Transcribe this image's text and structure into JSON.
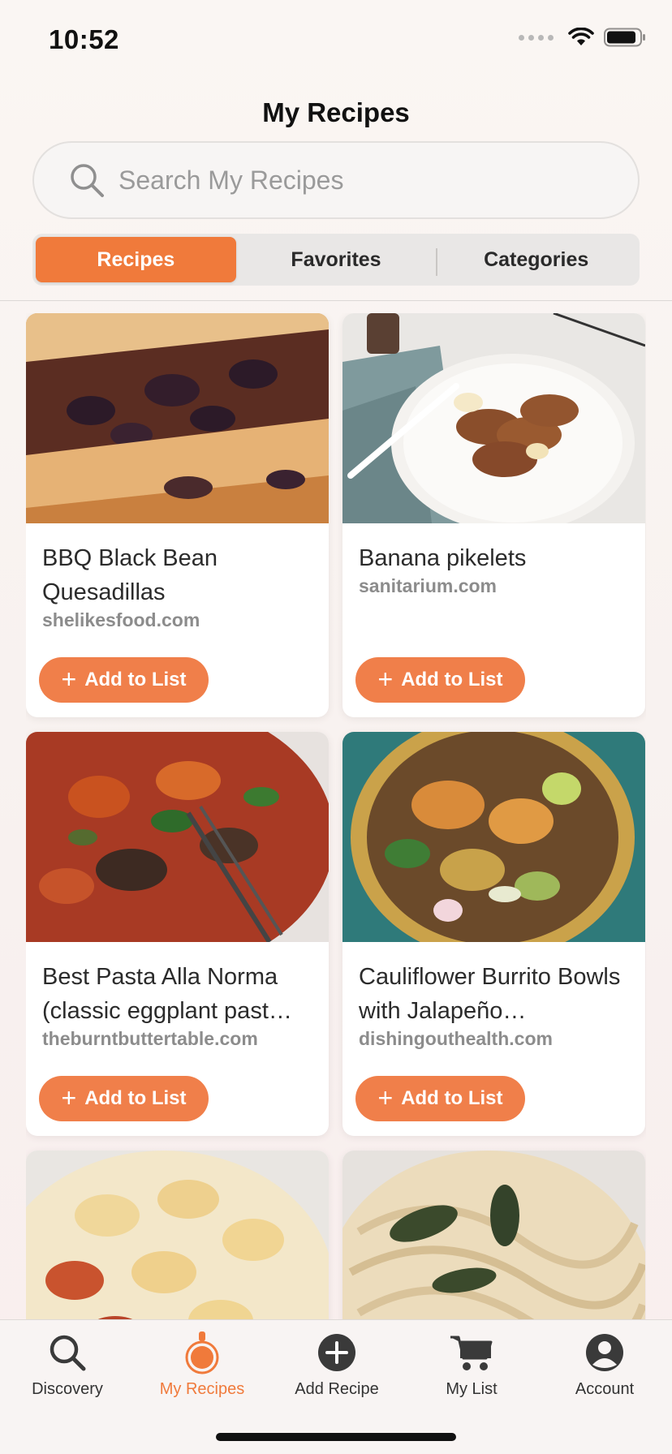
{
  "status_bar": {
    "time": "10:52"
  },
  "header": {
    "title": "My Recipes",
    "search_placeholder": "Search My Recipes",
    "segments": [
      {
        "label": "Recipes",
        "active": true
      },
      {
        "label": "Favorites",
        "active": false
      },
      {
        "label": "Categories",
        "active": false
      }
    ]
  },
  "recipes": [
    {
      "title": "BBQ Black Bean Quesadillas",
      "source": "shelikesfood.com",
      "button": "Add to List",
      "image": "quesadilla-photo"
    },
    {
      "title": "Banana pikelets",
      "source": "sanitarium.com",
      "button": "Add to List",
      "image": "pikelets-photo"
    },
    {
      "title": "Best Pasta Alla Norma (classic eggplant past…",
      "source": "theburntbuttertable.com",
      "button": "Add to List",
      "image": "pasta-norma-photo"
    },
    {
      "title": "Cauliflower Burrito Bowls with Jalapeño…",
      "source": "dishingouthealth.com",
      "button": "Add to List",
      "image": "burrito-bowl-photo"
    },
    {
      "title": "",
      "source": "",
      "button": "",
      "image": "tortellini-photo"
    },
    {
      "title": "",
      "source": "",
      "button": "",
      "image": "creamy-pasta-photo"
    }
  ],
  "tab_bar": {
    "tabs": [
      {
        "label": "Discovery",
        "icon": "search-icon",
        "active": false
      },
      {
        "label": "My Recipes",
        "icon": "recipe-pot-icon",
        "active": true
      },
      {
        "label": "Add Recipe",
        "icon": "add-circle-icon",
        "active": false
      },
      {
        "label": "My List",
        "icon": "cart-icon",
        "active": false
      },
      {
        "label": "Account",
        "icon": "account-icon",
        "active": false
      }
    ]
  },
  "colors": {
    "accent": "#f07a3b",
    "button": "#f07f4a"
  }
}
